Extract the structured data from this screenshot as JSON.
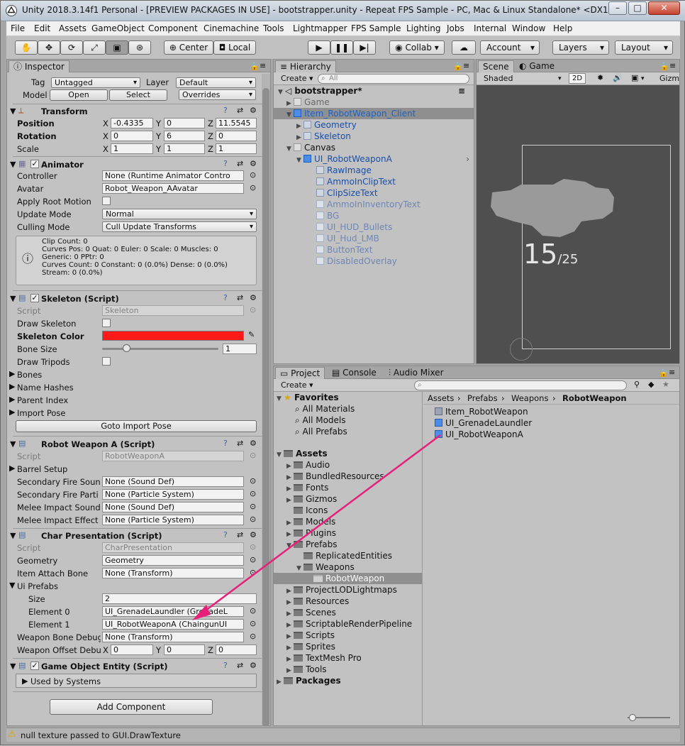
{
  "window": {
    "title": "Unity 2018.3.14f1 Personal - [PREVIEW PACKAGES IN USE] - bootstrapper.unity - Repeat FPS Sample - PC, Mac & Linux Standalone* <DX11>",
    "min": "–",
    "max": "□",
    "close": "✕"
  },
  "menu": [
    "File",
    "Edit",
    "Assets",
    "GameObject",
    "Component",
    "Cinemachine",
    "Tools",
    "Lightmapper",
    "FPS Sample",
    "Lighting",
    "Jobs",
    "Internal",
    "Window",
    "Help"
  ],
  "toolbar": {
    "center": "Center",
    "local": "Local",
    "collab": "Collab ▾",
    "account": "Account",
    "layers": "Layers",
    "layout": "Layout"
  },
  "inspector": {
    "tab": "Inspector",
    "tag_label": "Tag",
    "tag_value": "Untagged",
    "layer_label": "Layer",
    "layer_value": "Default",
    "model_label": "Model",
    "open": "Open",
    "select": "Select",
    "overrides": "Overrides",
    "transform": {
      "title": "Transform",
      "position": "Position",
      "rotation": "Rotation",
      "scale": "Scale",
      "pos": [
        "-0.4335",
        "0",
        "11.5545"
      ],
      "rot": [
        "0",
        "6",
        "0"
      ],
      "scl": [
        "1",
        "1",
        "1"
      ]
    },
    "animator": {
      "title": "Animator",
      "controller_label": "Controller",
      "controller": "None (Runtime Animator Contro",
      "avatar_label": "Avatar",
      "avatar": "Robot_Weapon_AAvatar",
      "apply_root": "Apply Root Motion",
      "update_label": "Update Mode",
      "update": "Normal",
      "culling_label": "Culling Mode",
      "culling": "Cull Update Transforms",
      "info": [
        "Clip Count: 0",
        "Curves Pos: 0 Quat: 0 Euler: 0 Scale: 0 Muscles: 0",
        "Generic: 0 PPtr: 0",
        "Curves Count: 0 Constant: 0 (0.0%) Dense: 0 (0.0%)",
        "Stream: 0 (0.0%)"
      ]
    },
    "skeleton": {
      "title": "Skeleton (Script)",
      "script_label": "Script",
      "script": "Skeleton",
      "draw_skel": "Draw Skeleton",
      "skel_color": "Skeleton Color",
      "bone_size": "Bone Size",
      "bone_size_val": "1",
      "draw_tripods": "Draw Tripods",
      "bones": "Bones",
      "name_hashes": "Name Hashes",
      "parent_index": "Parent Index",
      "import_pose": "Import Pose",
      "goto": "Goto Import Pose",
      "color": "#ff1a1a"
    },
    "robot": {
      "title": "Robot Weapon A (Script)",
      "script_label": "Script",
      "script": "RobotWeaponA",
      "barrel": "Barrel Setup",
      "rows": [
        {
          "label": "Secondary Fire Soun",
          "value": "None (Sound Def)"
        },
        {
          "label": "Secondary Fire Parti",
          "value": "None (Particle System)"
        },
        {
          "label": "Melee Impact Sound",
          "value": "None (Sound Def)"
        },
        {
          "label": "Melee Impact Effect",
          "value": "None (Particle System)"
        }
      ]
    },
    "charpres": {
      "title": "Char Presentation (Script)",
      "script_label": "Script",
      "script": "CharPresentation",
      "geometry_label": "Geometry",
      "geometry": "Geometry",
      "attach_label": "Item Attach Bone",
      "attach": "None (Transform)",
      "ui_prefabs": "Ui Prefabs",
      "size_label": "Size",
      "size": "2",
      "el0_label": "Element 0",
      "el0": "UI_GrenadeLaundler (GrenadeL",
      "el1_label": "Element 1",
      "el1": "UI_RobotWeaponA (ChaingunUI",
      "wbd_label": "Weapon Bone Debug",
      "wbd": "None (Transform)",
      "wod_label": "Weapon Offset Debu",
      "wod": [
        "0",
        "0",
        "0"
      ]
    },
    "gee": {
      "title": "Game Object Entity (Script)",
      "used": "Used by Systems"
    },
    "add": "Add Component"
  },
  "hierarchy": {
    "tab": "Hierarchy",
    "create": "Create ▾",
    "search": "All",
    "items": [
      {
        "text": "bootstrapper*",
        "style": "scene"
      },
      {
        "text": "Game",
        "style": "grey"
      },
      {
        "text": "Item_RobotWeapon_Client",
        "style": "sel"
      },
      {
        "text": "Geometry",
        "style": "blue"
      },
      {
        "text": "Skeleton",
        "style": "blue"
      },
      {
        "text": "Canvas",
        "style": "normal"
      },
      {
        "text": "UI_RobotWeaponA",
        "style": "blue"
      },
      {
        "text": "RawImage",
        "style": "blue"
      },
      {
        "text": "AmmoInClipText",
        "style": "blue"
      },
      {
        "text": "ClipSizeText",
        "style": "blue"
      },
      {
        "text": "AmmoInInventoryText",
        "style": "greyblue"
      },
      {
        "text": "BG",
        "style": "greyblue"
      },
      {
        "text": "UI_HUD_Bullets",
        "style": "greyblue"
      },
      {
        "text": "UI_Hud_LMB",
        "style": "greyblue"
      },
      {
        "text": "ButtonText",
        "style": "greyblue"
      },
      {
        "text": "DisabledOverlay",
        "style": "greyblue"
      }
    ]
  },
  "scene": {
    "tab_scene": "Scene",
    "tab_game": "Game",
    "shaded": "Shaded",
    "mode2d": "2D",
    "gizmos": "Gizm",
    "ammo": "15",
    "clip": "/25"
  },
  "project": {
    "tab": "Project",
    "console": "Console",
    "audio": "Audio Mixer",
    "create": "Create ▾",
    "favorites": "Favorites",
    "fav_items": [
      "All Materials",
      "All Models",
      "All Prefabs"
    ],
    "assets": "Assets",
    "folders": [
      "Audio",
      "BundledResources",
      "Fonts",
      "Gizmos",
      "Icons",
      "Models",
      "Plugins",
      "Prefabs",
      "ReplicatedEntities",
      "Weapons",
      "RobotWeapon",
      "ProjectLODLightmaps",
      "Resources",
      "Scenes",
      "ScriptableRenderPipeline",
      "Scripts",
      "Sprites",
      "TextMesh Pro",
      "Tools"
    ],
    "packages": "Packages",
    "breadcrumb": [
      "Assets",
      "Prefabs",
      "Weapons",
      "RobotWeapon"
    ],
    "files": [
      "Item_RobotWeapon",
      "UI_GrenadeLaundler",
      "UI_RobotWeaponA"
    ]
  },
  "status": "null texture passed to GUI.DrawTexture",
  "annotation_color": "#e8207a"
}
